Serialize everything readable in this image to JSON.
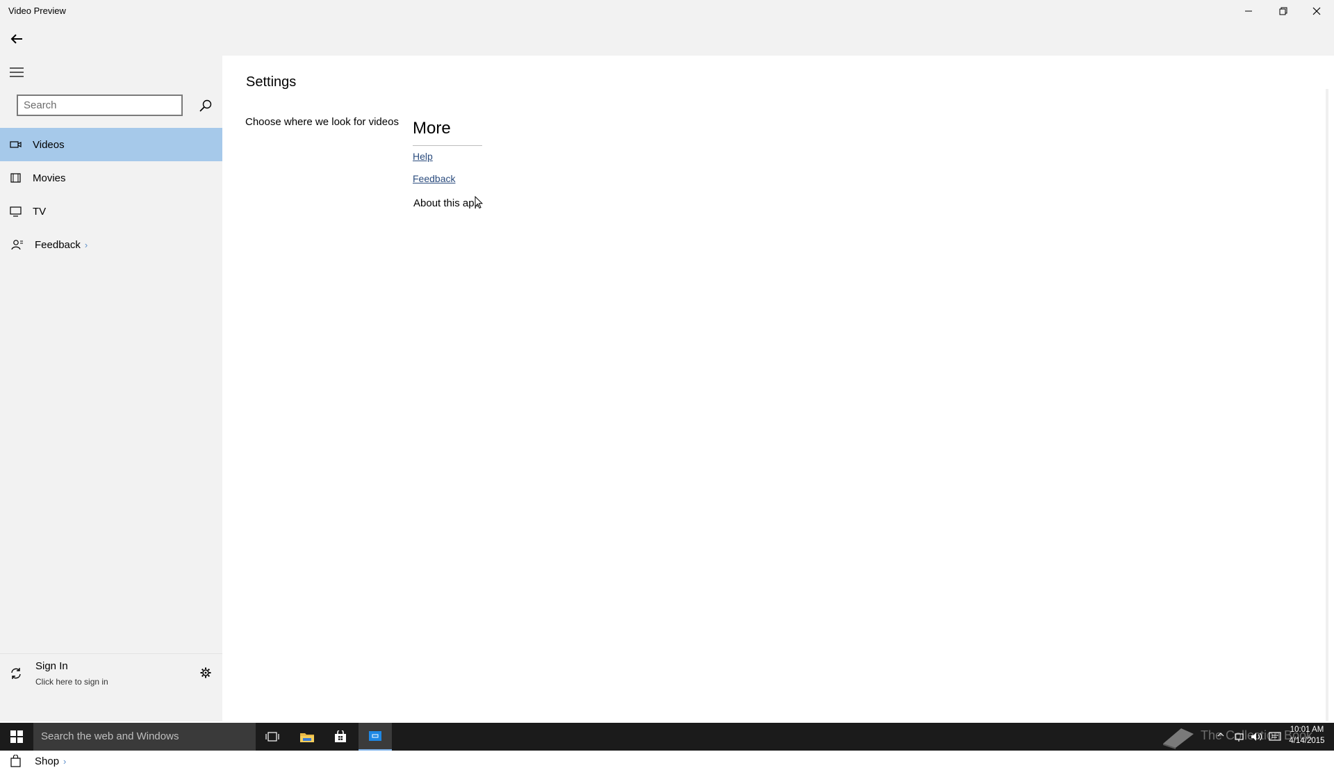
{
  "window": {
    "title": "Video Preview"
  },
  "sidebar": {
    "search_placeholder": "Search",
    "items": [
      {
        "label": "Videos",
        "icon": "video-camera-icon",
        "active": true
      },
      {
        "label": "Movies",
        "icon": "film-icon",
        "active": false
      },
      {
        "label": "TV",
        "icon": "tv-icon",
        "active": false
      },
      {
        "label": "Feedback",
        "icon": "feedback-icon",
        "chevron": "›"
      }
    ],
    "signin": {
      "title": "Sign In",
      "subtitle": "Click here to sign in"
    },
    "shop": {
      "label": "Shop",
      "chevron": "›"
    }
  },
  "main": {
    "title": "Settings",
    "choose_label": "Choose where we look for videos",
    "more": {
      "title": "More",
      "help_link": "Help",
      "feedback_link": "Feedback",
      "about": "About this app"
    }
  },
  "taskbar": {
    "search_placeholder": "Search the web and Windows",
    "watermark": "The Collection Book",
    "clock": {
      "time": "10:01 AM",
      "date": "4/14/2015"
    }
  },
  "colors": {
    "accent_active": "#a6c9ea",
    "taskbar": "#1b1b1b",
    "chrome": "#f2f2f2",
    "link": "#2b4c7e"
  }
}
